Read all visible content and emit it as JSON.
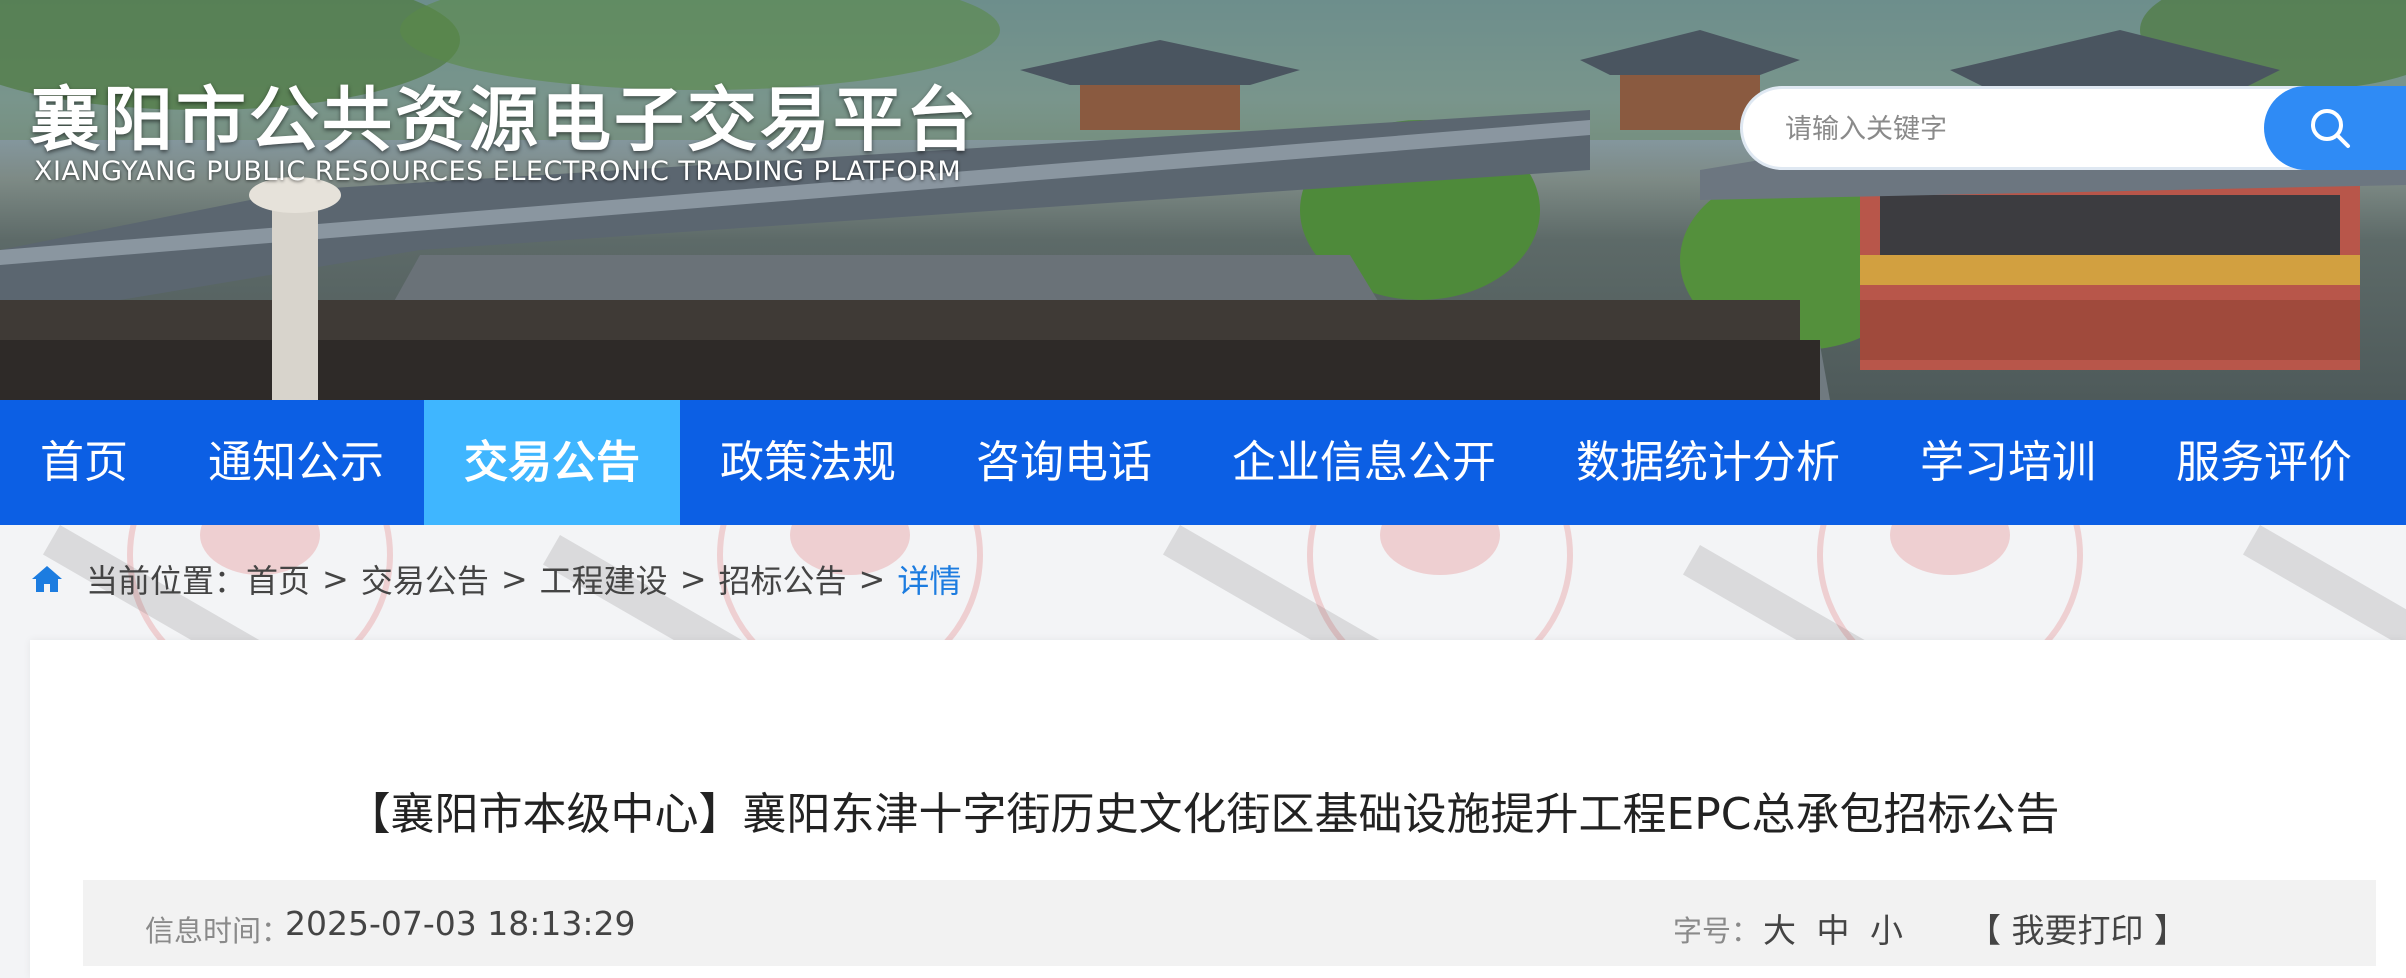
{
  "header": {
    "title": "襄阳市公共资源电子交易平台",
    "subtitle": "XIANGYANG PUBLIC RESOURCES ELECTRONIC TRADING PLATFORM",
    "search_placeholder": "请输入关键字"
  },
  "nav": {
    "items": [
      {
        "label": "首页"
      },
      {
        "label": "通知公示"
      },
      {
        "label": "交易公告",
        "active": true
      },
      {
        "label": "政策法规"
      },
      {
        "label": "咨询电话"
      },
      {
        "label": "企业信息公开"
      },
      {
        "label": "数据统计分析"
      },
      {
        "label": "学习培训"
      },
      {
        "label": "服务评价"
      }
    ]
  },
  "breadcrumb": {
    "prefix": "当前位置：",
    "items": [
      "首页",
      "交易公告",
      "工程建设",
      "招标公告",
      "详情"
    ],
    "separator": ">"
  },
  "article": {
    "title": "【襄阳市本级中心】襄阳东津十字街历史文化街区基础设施提升工程EPC总承包招标公告",
    "info_time_label": "信息时间：",
    "info_time": "2025-07-03 18:13:29",
    "font_size_label": "字号：",
    "font_size_options": [
      "大",
      "中",
      "小"
    ],
    "print_label": "【 我要打印 】"
  },
  "colors": {
    "nav_bg": "#0c5fe4",
    "nav_active_bg": "#3fb6ff",
    "search_button": "#2f8bf5",
    "breadcrumb_current": "#1c7ce0"
  }
}
